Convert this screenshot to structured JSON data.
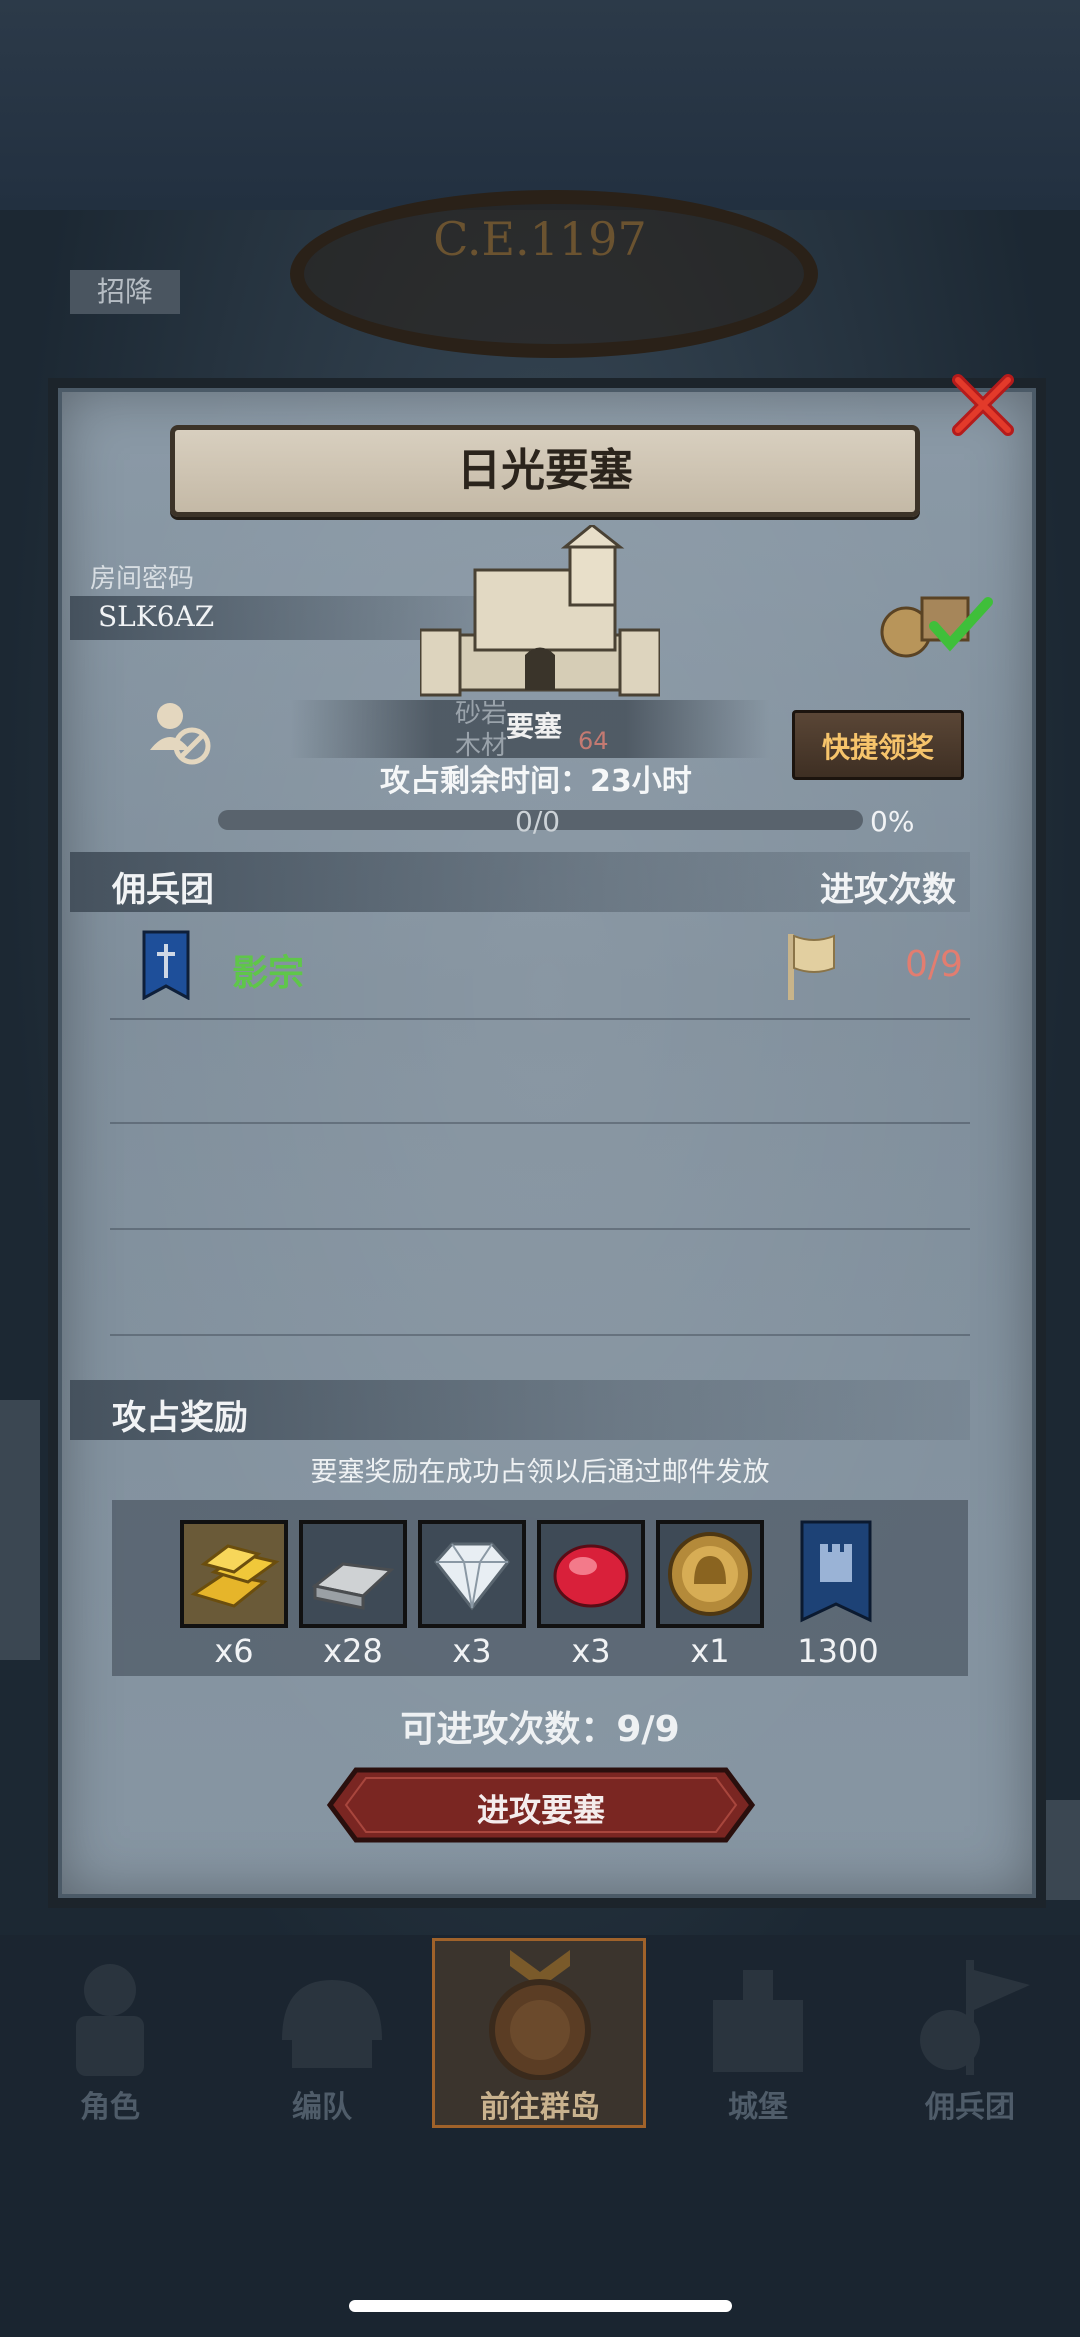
{
  "background": {
    "era_label": "C.E.1197",
    "left_tab_label": "招降"
  },
  "dialog": {
    "title": "日光要塞",
    "room_code_label": "房间密码",
    "room_code": "SLK6AZ",
    "resources": {
      "stone_label": "砂岩",
      "wood_label": "木材",
      "wood_value": "64"
    },
    "fortress_tag": "要塞",
    "claim_button_label": "快捷领奖",
    "time_remaining": "攻占剩余时间：23小时",
    "progress": {
      "count": "0/0",
      "percent": "0%",
      "fraction": 0
    },
    "mercenary_header": "佣兵团",
    "attack_count_header": "进攻次数",
    "guild": {
      "name": "影宗",
      "attacks": "0/9"
    },
    "reward_header": "攻占奖励",
    "reward_note": "要塞奖励在成功占领以后通过邮件发放",
    "rewards": [
      {
        "icon": "gold-bars-icon",
        "qty": "x6"
      },
      {
        "icon": "iron-ingot-icon",
        "qty": "x28"
      },
      {
        "icon": "diamond-icon",
        "qty": "x3"
      },
      {
        "icon": "ruby-icon",
        "qty": "x3"
      },
      {
        "icon": "knight-medal-icon",
        "qty": "x1"
      },
      {
        "icon": "castle-banner-icon",
        "qty": "1300"
      }
    ],
    "attempts_label": "可进攻次数：9/9",
    "attack_button_label": "进攻要塞"
  },
  "nav": [
    {
      "label": "角色",
      "icon": "knight-icon"
    },
    {
      "label": "编队",
      "icon": "helmet-icon"
    },
    {
      "label": "前往群岛",
      "icon": "compass-icon",
      "active": true
    },
    {
      "label": "城堡",
      "icon": "castle-icon"
    },
    {
      "label": "佣兵团",
      "icon": "banner-icon"
    }
  ],
  "colors": {
    "guild_name": "#5fc64a",
    "attack_count": "#e27d70",
    "claim_text": "#f6c46b",
    "attack_button": "#7a2622"
  }
}
